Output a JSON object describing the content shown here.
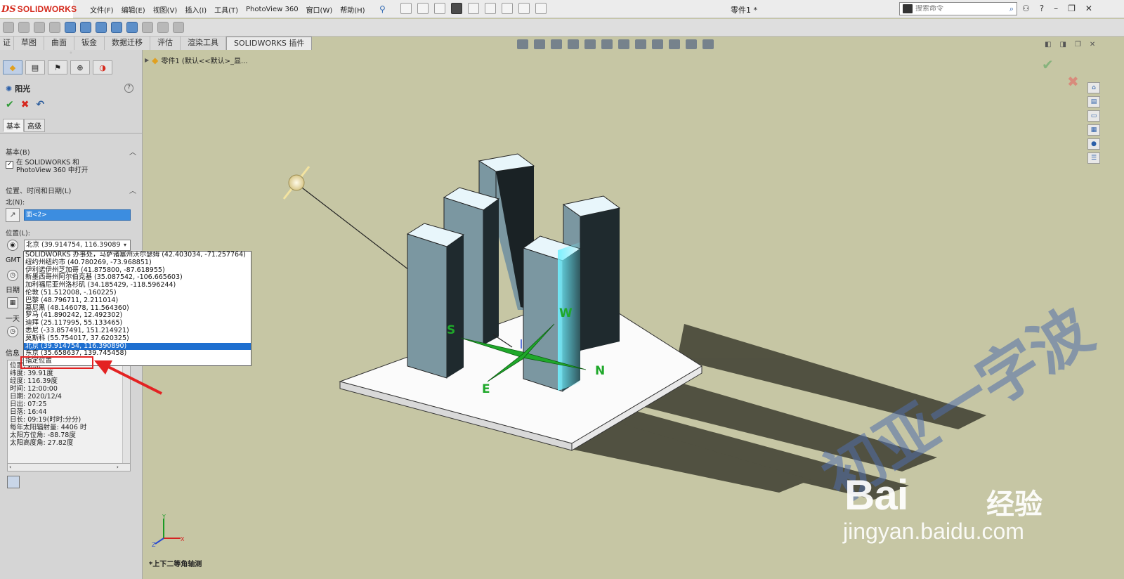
{
  "app": {
    "brand_ds": "DS",
    "brand_name": "SOLIDWORKS",
    "doc_title": "零件1 *",
    "menus": [
      "文件(F)",
      "编辑(E)",
      "视图(V)",
      "插入(I)",
      "工具(T)",
      "PhotoView 360",
      "窗口(W)",
      "帮助(H)"
    ],
    "search_placeholder": "搜索命令"
  },
  "command_tabs": [
    "证",
    "草图",
    "曲面",
    "钣金",
    "数据迁移",
    "评估",
    "渲染工具",
    "SOLIDWORKS 插件"
  ],
  "active_command_tab": "SOLIDWORKS 插件",
  "feature_tree": {
    "item": "零件1 (默认<<默认>_显..."
  },
  "property_manager": {
    "title": "阳光",
    "tabs": [
      "基本",
      "高级"
    ],
    "group_basic": {
      "header": "基本(B)",
      "checkbox_label_line1": "在 SOLIDWORKS 和",
      "checkbox_label_line2": "PhotoView 360 中打开",
      "checked": true
    },
    "group_location": {
      "header": "位置、时间和日期(L)",
      "north_label": "北(N):",
      "north_value": "面<2>",
      "location_label": "位置(L):",
      "location_value": "北京 (39.914754, 116.390890)",
      "gmt_label": "GMT",
      "date_label": "日期",
      "day_label": "一天"
    },
    "info": {
      "header": "信息",
      "rows": [
        "位置: 北京",
        "纬度: 39.91度",
        "经度: 116.39度",
        "时间: 12:00:00",
        "日期: 2020/12/4",
        "日出: 07:25",
        "日落: 16:44",
        "日长: 09:19(时时:分分)",
        "每年太阳辐射量: 4406 时",
        "太阳方位角: -88.78度",
        "太阳高度角: 27.82度"
      ]
    }
  },
  "location_dropdown": {
    "items": [
      "SOLIDWORKS 办事处，马萨诸塞州沃尔瑟姆 (42.403034, -71.257764)",
      "纽约州纽约市 (40.780269, -73.968851)",
      "伊利诺伊州芝加哥 (41.875800, -87.618955)",
      "新墨西哥州阿尔伯克基 (35.087542, -106.665603)",
      "加利福尼亚州洛杉矶 (34.185429, -118.596244)",
      "伦敦 (51.512008, -.160225)",
      "巴黎 (48.796711, 2.211014)",
      "慕尼黑 (48.146078, 11.564360)",
      "罗马 (41.890242, 12.492302)",
      "迪拜 (25.117995, 55.133465)",
      "悉尼 (-33.857491, 151.214921)",
      "莫斯科 (55.754017, 37.620325)",
      "北京 (39.914754, 116.390890)",
      "东京 (35.658637, 139.745458)",
      "指定位置"
    ],
    "selected_index": 12
  },
  "scene": {
    "compass_labels": [
      "S",
      "W",
      "N",
      "E"
    ],
    "view_name": "*上下二等角轴测",
    "triad_axes": [
      "Y",
      "X",
      "Z"
    ]
  },
  "watermark": {
    "big": "初亚一字波",
    "brand": "Bai",
    "brand2": "经验",
    "url": "jingyan.baidu.com"
  },
  "colors": {
    "accent": "#1e6fd0",
    "highlight_red": "#e32222",
    "viewport_bg": "#c6c6a4",
    "building": "#7b97a1",
    "compass_green": "#1fa82a"
  }
}
